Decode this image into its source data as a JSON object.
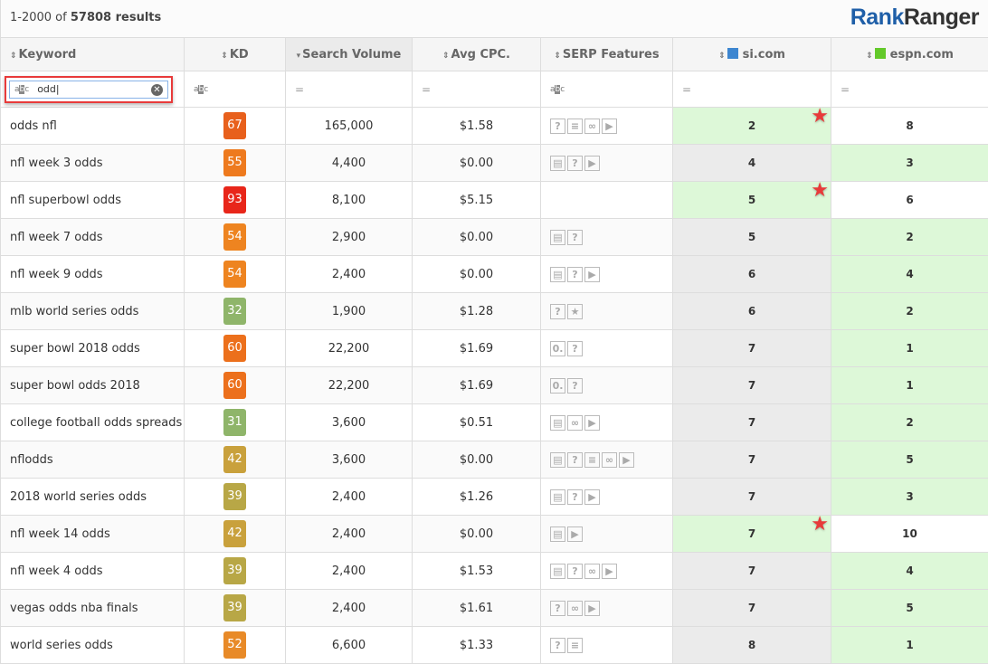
{
  "results": {
    "range": "1-2000 of",
    "total": "57808 results"
  },
  "logo": {
    "part1": "Rank",
    "part2": "Ranger"
  },
  "columns": [
    {
      "label": "Keyword",
      "sort": "both"
    },
    {
      "label": "KD",
      "sort": "both"
    },
    {
      "label": "Search Volume",
      "sort": "desc"
    },
    {
      "label": "Avg CPC.",
      "sort": "both"
    },
    {
      "label": "SERP Features",
      "sort": "both"
    },
    {
      "label": "si.com",
      "sort": "both",
      "color": "#3d86d0"
    },
    {
      "label": "espn.com",
      "sort": "both",
      "color": "#63c92a"
    }
  ],
  "filters": {
    "keyword_value": "odd",
    "text_icon": "abc",
    "num_icon": "="
  },
  "rows": [
    {
      "keyword": "odds nfl",
      "kd": 67,
      "kd_color": "#e8601c",
      "volume": "165,000",
      "cpc": "$1.58",
      "serp": [
        "question",
        "news",
        "link",
        "video"
      ],
      "si": "2",
      "espn": "8",
      "winner": "si"
    },
    {
      "keyword": "nfl week 3 odds",
      "kd": 55,
      "kd_color": "#ee7a1e",
      "volume": "4,400",
      "cpc": "$0.00",
      "serp": [
        "carousel",
        "question",
        "video"
      ],
      "si": "4",
      "espn": "3",
      "winner": "espn"
    },
    {
      "keyword": "nfl superbowl odds",
      "kd": 93,
      "kd_color": "#e8261a",
      "volume": "8,100",
      "cpc": "$5.15",
      "serp": [],
      "si": "5",
      "espn": "6",
      "winner": "si"
    },
    {
      "keyword": "nfl week 7 odds",
      "kd": 54,
      "kd_color": "#ee8420",
      "volume": "2,900",
      "cpc": "$0.00",
      "serp": [
        "carousel",
        "question"
      ],
      "si": "5",
      "espn": "2",
      "winner": "espn"
    },
    {
      "keyword": "nfl week 9 odds",
      "kd": 54,
      "kd_color": "#ee8420",
      "volume": "2,400",
      "cpc": "$0.00",
      "serp": [
        "carousel",
        "question",
        "video"
      ],
      "si": "6",
      "espn": "4",
      "winner": "espn"
    },
    {
      "keyword": "mlb world series odds",
      "kd": 32,
      "kd_color": "#8fb56a",
      "volume": "1,900",
      "cpc": "$1.28",
      "serp": [
        "question",
        "star"
      ],
      "si": "6",
      "espn": "2",
      "winner": "espn"
    },
    {
      "keyword": "super bowl 2018 odds",
      "kd": 60,
      "kd_color": "#ec701c",
      "volume": "22,200",
      "cpc": "$1.69",
      "serp": [
        "snippet",
        "question"
      ],
      "si": "7",
      "espn": "1",
      "winner": "espn"
    },
    {
      "keyword": "super bowl odds 2018",
      "kd": 60,
      "kd_color": "#ec701c",
      "volume": "22,200",
      "cpc": "$1.69",
      "serp": [
        "snippet",
        "question"
      ],
      "si": "7",
      "espn": "1",
      "winner": "espn"
    },
    {
      "keyword": "college football odds spreads",
      "kd": 31,
      "kd_color": "#8fb56a",
      "volume": "3,600",
      "cpc": "$0.51",
      "serp": [
        "carousel",
        "link",
        "video"
      ],
      "si": "7",
      "espn": "2",
      "winner": "espn"
    },
    {
      "keyword": "nflodds",
      "kd": 42,
      "kd_color": "#c9a13c",
      "volume": "3,600",
      "cpc": "$0.00",
      "serp": [
        "carousel",
        "question",
        "news",
        "link",
        "video"
      ],
      "si": "7",
      "espn": "5",
      "winner": "espn"
    },
    {
      "keyword": "2018 world series odds",
      "kd": 39,
      "kd_color": "#b8a746",
      "volume": "2,400",
      "cpc": "$1.26",
      "serp": [
        "carousel",
        "question",
        "video"
      ],
      "si": "7",
      "espn": "3",
      "winner": "espn"
    },
    {
      "keyword": "nfl week 14 odds",
      "kd": 42,
      "kd_color": "#c9a13c",
      "volume": "2,400",
      "cpc": "$0.00",
      "serp": [
        "carousel",
        "video"
      ],
      "si": "7",
      "espn": "10",
      "winner": "si"
    },
    {
      "keyword": "nfl week 4 odds",
      "kd": 39,
      "kd_color": "#b8a746",
      "volume": "2,400",
      "cpc": "$1.53",
      "serp": [
        "carousel",
        "question",
        "link",
        "video"
      ],
      "si": "7",
      "espn": "4",
      "winner": "espn"
    },
    {
      "keyword": "vegas odds nba finals",
      "kd": 39,
      "kd_color": "#b8a746",
      "volume": "2,400",
      "cpc": "$1.61",
      "serp": [
        "question",
        "link",
        "video"
      ],
      "si": "7",
      "espn": "5",
      "winner": "espn"
    },
    {
      "keyword": "world series odds",
      "kd": 52,
      "kd_color": "#e88a28",
      "volume": "6,600",
      "cpc": "$1.33",
      "serp": [
        "question",
        "news"
      ],
      "si": "8",
      "espn": "1",
      "winner": "espn"
    }
  ]
}
